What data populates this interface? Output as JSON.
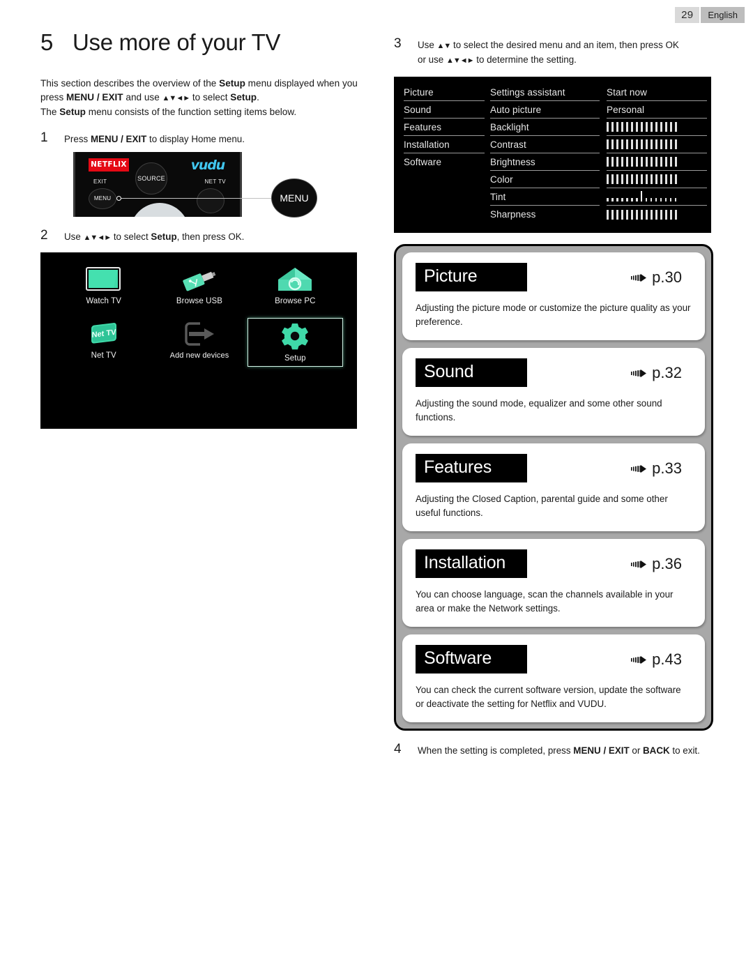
{
  "header": {
    "page_number": "29",
    "language": "English"
  },
  "chapter": {
    "number": "5",
    "title": "Use more of your TV"
  },
  "intro": {
    "line1_a": "This section describes the overview of the ",
    "line1_b": "Setup",
    "line1_c": " menu displayed when you press ",
    "line1_d": "MENU / EXIT",
    "line1_e": " and use ",
    "line1_f": "▲▼◄►",
    "line1_g": " to select ",
    "line1_h": "Setup",
    "line1_i": ".",
    "line2_a": "The ",
    "line2_b": "Setup",
    "line2_c": " menu consists of the function setting items below."
  },
  "steps": {
    "step1": {
      "number": "1",
      "text_a": "Press ",
      "text_b": "MENU / EXIT",
      "text_c": " to display Home menu."
    },
    "step2": {
      "number": "2",
      "text_a": "Use ",
      "arrows": "▲▼◄►",
      "text_b": " to select ",
      "text_c": "Setup",
      "text_d": ", then press OK."
    },
    "step3": {
      "number": "3",
      "line1_a": "Use ",
      "line1_arrows": "▲▼",
      "line1_b": " to select the desired menu and an item, then press OK",
      "line2_a": "or use ",
      "line2_arrows": "▲▼◄►",
      "line2_b": " to determine the setting."
    },
    "step4": {
      "number": "4",
      "text_a": "When the setting is completed, press ",
      "text_b": "MENU / EXIT",
      "text_c": " or ",
      "text_d": "BACK",
      "text_e": " to exit."
    }
  },
  "remote": {
    "netflix_label": "NETFLIX",
    "vudu_label": "vudu",
    "source_label": "SOURCE",
    "exit_label": "EXIT",
    "menu_label": "MENU",
    "nettv_label": "NET TV",
    "callout_label": "MENU"
  },
  "home_menu": {
    "tiles": [
      {
        "label": "Watch TV",
        "icon": "tv-icon",
        "selected": false
      },
      {
        "label": "Browse USB",
        "icon": "usb-drive-icon",
        "selected": false
      },
      {
        "label": "Browse PC",
        "icon": "house-network-icon",
        "selected": false
      },
      {
        "label": "Net TV",
        "icon": "net-tv-icon",
        "selected": false
      },
      {
        "label": "Add new devices",
        "icon": "add-device-icon",
        "selected": false
      },
      {
        "label": "Setup",
        "icon": "gear-icon",
        "selected": true
      }
    ]
  },
  "setup_menu": {
    "nav": [
      "Picture",
      "Sound",
      "Features",
      "Installation",
      "Software"
    ],
    "items": [
      {
        "label": "Settings assistant",
        "value": "Start now",
        "type": "text"
      },
      {
        "label": "Auto picture",
        "value": "Personal",
        "type": "text"
      },
      {
        "label": "Backlight",
        "value": "",
        "type": "slider"
      },
      {
        "label": "Contrast",
        "value": "",
        "type": "slider"
      },
      {
        "label": "Brightness",
        "value": "",
        "type": "slider"
      },
      {
        "label": "Color",
        "value": "",
        "type": "slider"
      },
      {
        "label": "Tint",
        "value": "",
        "type": "slider-center"
      },
      {
        "label": "Sharpness",
        "value": "",
        "type": "slider"
      }
    ]
  },
  "cards": [
    {
      "title": "Picture",
      "page": "p.30",
      "description": "Adjusting the picture mode or customize the picture quality as your preference."
    },
    {
      "title": "Sound",
      "page": "p.32",
      "description": "Adjusting the sound mode, equalizer and some other sound functions."
    },
    {
      "title": "Features",
      "page": "p.33",
      "description": "Adjusting the Closed Caption, parental guide and some other useful functions."
    },
    {
      "title": "Installation",
      "page": "p.36",
      "description": "You can choose language, scan the channels available in your area or make the Network settings."
    },
    {
      "title": "Software",
      "page": "p.43",
      "description": "You can check the current software version, update the software or deactivate the setting for Netflix and VUDU."
    }
  ],
  "colors": {
    "accent_green": "#3fd9a8",
    "netflix_red": "#e50914",
    "vudu_blue": "#41c7f0",
    "card_gray": "#a8a8a8"
  }
}
